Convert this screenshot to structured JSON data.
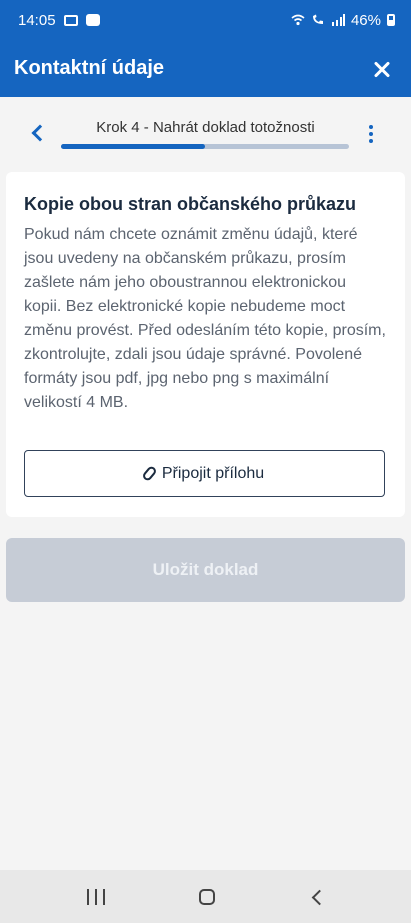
{
  "status_bar": {
    "time": "14:05",
    "battery": "46%"
  },
  "app_bar": {
    "title": "Kontaktní údaje"
  },
  "step": {
    "label": "Krok 4 - Nahrát doklad totožnosti",
    "progress_fraction": 0.5
  },
  "card": {
    "title": "Kopie obou stran občanského průkazu",
    "text": "Pokud nám chcete oznámit změnu údajů, které jsou uvedeny na občanském průkazu, prosím zašlete nám jeho oboustrannou elektronickou kopii. Bez elektronické kopie nebudeme moct změnu provést. Před odesláním této kopie, prosím, zkontrolujte, zdali jsou údaje správné. Povolené formáty jsou pdf, jpg nebo png s maximální velikostí 4 MB.",
    "attach_label": "Připojit přílohu"
  },
  "save": {
    "label": "Uložit doklad"
  },
  "colors": {
    "primary": "#1565c0",
    "disabled_button": "#c6ccd6",
    "background": "#f4f4f4"
  },
  "icons": {
    "back": "chevron-left-icon",
    "close": "close-icon",
    "more": "more-vertical-icon",
    "attach": "paperclip-icon"
  }
}
